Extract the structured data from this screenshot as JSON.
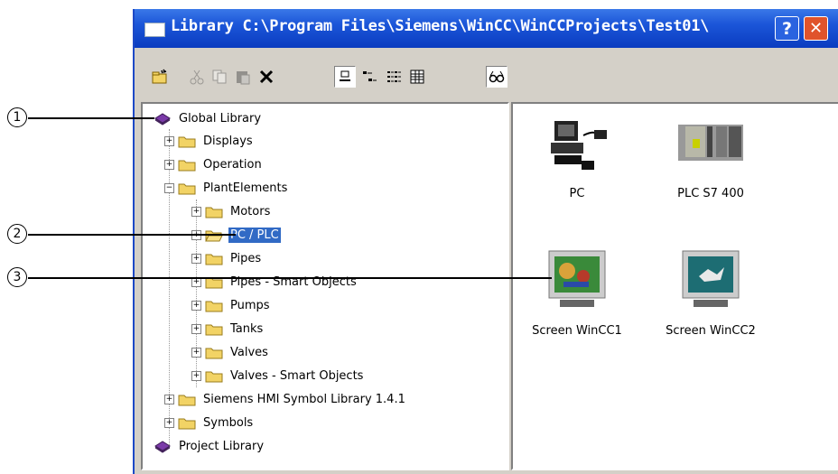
{
  "window": {
    "title": "Library  C:\\Program Files\\Siemens\\WinCC\\WinCCProjects\\Test01\\",
    "help_label": "?",
    "close_label": "✕"
  },
  "toolbar": {
    "buttons": [
      "new-folder-icon",
      "cut-icon",
      "copy-icon",
      "paste-icon",
      "delete-icon",
      "large-icons-icon",
      "small-icons-icon",
      "list-icon",
      "details-icon",
      "preview-icon"
    ]
  },
  "tree": {
    "items": [
      {
        "label": "Global Library"
      },
      {
        "label": "Displays"
      },
      {
        "label": "Operation"
      },
      {
        "label": "PlantElements"
      },
      {
        "label": "Motors"
      },
      {
        "label": "PC / PLC"
      },
      {
        "label": "Pipes"
      },
      {
        "label": "Pipes - Smart Objects"
      },
      {
        "label": "Pumps"
      },
      {
        "label": "Tanks"
      },
      {
        "label": "Valves"
      },
      {
        "label": "Valves - Smart Objects"
      },
      {
        "label": "Siemens HMI Symbol Library 1.4.1"
      },
      {
        "label": "Symbols"
      },
      {
        "label": "Project Library"
      }
    ]
  },
  "objects": [
    {
      "label": "PC"
    },
    {
      "label": "PLC S7 400"
    },
    {
      "label": "Screen WinCC1"
    },
    {
      "label": "Screen WinCC2"
    }
  ],
  "callouts": [
    "1",
    "2",
    "3"
  ],
  "colors": {
    "titlebar": "#0a3cc0",
    "selection": "#316ac5",
    "folder": "#f2d365"
  }
}
